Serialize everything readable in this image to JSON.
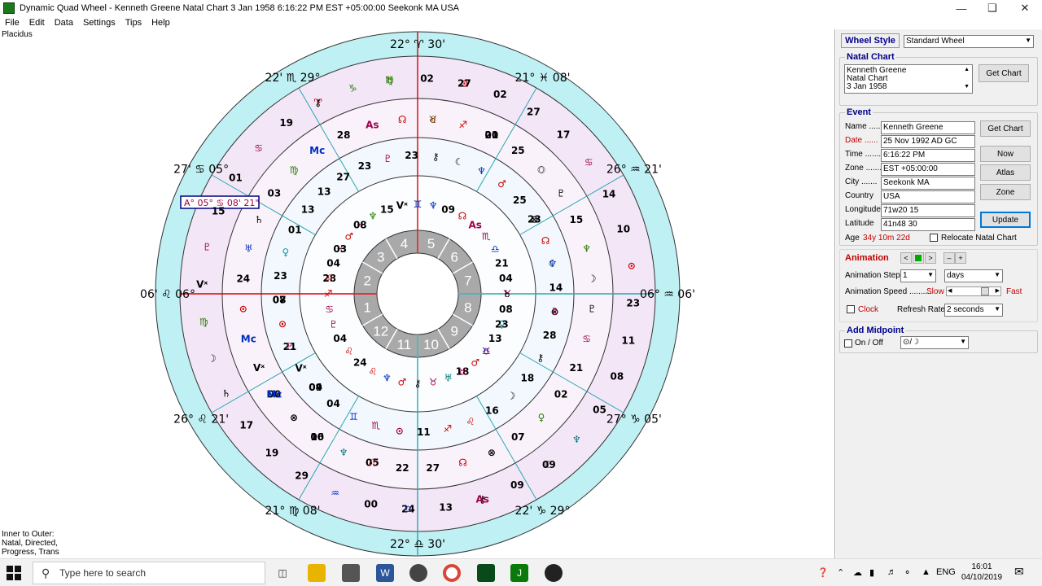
{
  "window": {
    "title": "Dynamic Quad Wheel - Kenneth Greene Natal Chart 3 Jan 1958 6:16:22 PM EST +05:00:00 Seekonk MA USA"
  },
  "menu": [
    "File",
    "Edit",
    "Data",
    "Settings",
    "Tips",
    "Help"
  ],
  "wheel": {
    "house_system": "Placidus",
    "legend": [
      "Inner to Outer:",
      "Natal, Directed,",
      "Progress, Trans"
    ],
    "asc_readout": "A° 05° ♋ 08' 21\"",
    "house_numbers": [
      "1",
      "2",
      "3",
      "4",
      "5",
      "6",
      "7",
      "8",
      "9",
      "10",
      "11",
      "12"
    ],
    "cusps": [
      {
        "deg": "22°",
        "sign": "♈",
        "min": "30'"
      },
      {
        "deg": "21°",
        "sign": "♓",
        "min": "08'"
      },
      {
        "deg": "26°",
        "sign": "♒",
        "min": "21'"
      },
      {
        "deg": "06°",
        "sign": "♒",
        "min": "06'"
      },
      {
        "deg": "27°",
        "sign": "♑",
        "min": "05'"
      },
      {
        "deg": "22'",
        "sign": "♑",
        "min": "29°"
      },
      {
        "deg": "22°",
        "sign": "♎",
        "min": "30'"
      },
      {
        "deg": "21°",
        "sign": "♍",
        "min": "08'"
      },
      {
        "deg": "26°",
        "sign": "♌",
        "min": "21'"
      },
      {
        "deg": "06'",
        "sign": "♌",
        "min": "06°"
      },
      {
        "deg": "27'",
        "sign": "♋",
        "min": "05°"
      },
      {
        "deg": "22'",
        "sign": "♏",
        "min": "29°"
      }
    ],
    "glyphs": [
      {
        "t": "♉",
        "c": "#a0004a"
      },
      {
        "t": "04",
        "c": "#000"
      },
      {
        "t": "♉",
        "c": "#2a7a00"
      },
      {
        "t": "☾",
        "c": "#000"
      },
      {
        "t": "28",
        "c": "#000"
      },
      {
        "t": "⊗",
        "c": "#000"
      },
      {
        "t": "05",
        "c": "#000"
      },
      {
        "t": "♈",
        "c": "#c00"
      },
      {
        "t": "♀",
        "c": "#00a0a0"
      },
      {
        "t": "21",
        "c": "#000"
      },
      {
        "t": "20",
        "c": "#000"
      },
      {
        "t": "⚷",
        "c": "#000"
      },
      {
        "t": "♓",
        "c": "#a0004a"
      },
      {
        "t": "☾",
        "c": "#000"
      },
      {
        "t": "00",
        "c": "#000"
      },
      {
        "t": "♉",
        "c": "#2a7a00"
      },
      {
        "t": "♉",
        "c": "#a0004a"
      },
      {
        "t": "08",
        "c": "#000"
      },
      {
        "t": "☾",
        "c": "#000"
      },
      {
        "t": "24",
        "c": "#000"
      },
      {
        "t": "♓",
        "c": "#a0004a"
      },
      {
        "t": "⊗",
        "c": "#000"
      },
      {
        "t": "00",
        "c": "#000"
      },
      {
        "t": "⊙",
        "c": "#c00"
      },
      {
        "t": "18",
        "c": "#000"
      },
      {
        "t": "♀",
        "c": "#00a0a0"
      },
      {
        "t": "15",
        "c": "#000"
      },
      {
        "t": "♒",
        "c": "#0030c0"
      },
      {
        "t": "15",
        "c": "#000"
      },
      {
        "t": "⚷",
        "c": "#000"
      },
      {
        "t": "Mc",
        "c": "#0030c0"
      },
      {
        "t": "27",
        "c": "#000"
      },
      {
        "t": "♉",
        "c": "#a0004a"
      },
      {
        "t": "13",
        "c": "#000"
      },
      {
        "t": "☽",
        "c": "#000"
      },
      {
        "t": "19",
        "c": "#000"
      },
      {
        "t": "♊",
        "c": "#0030c0"
      },
      {
        "t": "☽",
        "c": "#000"
      },
      {
        "t": "24",
        "c": "#000"
      },
      {
        "t": "♋",
        "c": "#a0004a"
      },
      {
        "t": "♂",
        "c": "#c00"
      },
      {
        "t": "27",
        "c": "#000"
      },
      {
        "t": "♋",
        "c": "#a0004a"
      },
      {
        "t": "♄",
        "c": "#000"
      },
      {
        "t": "09",
        "c": "#000"
      },
      {
        "t": "♌",
        "c": "#c00"
      },
      {
        "t": "♄",
        "c": "#000"
      },
      {
        "t": "10",
        "c": "#000"
      },
      {
        "t": "♌",
        "c": "#c00"
      },
      {
        "t": "♇",
        "c": "#a0004a"
      },
      {
        "t": "02",
        "c": "#000"
      },
      {
        "t": "♍",
        "c": "#2a7a00"
      },
      {
        "t": "As",
        "c": "#a0004a"
      },
      {
        "t": "11",
        "c": "#000"
      },
      {
        "t": "♍",
        "c": "#2a7a00"
      },
      {
        "t": "23",
        "c": "#000"
      },
      {
        "t": "♌",
        "c": "#c00"
      },
      {
        "t": "⚷",
        "c": "#000"
      },
      {
        "t": "07",
        "c": "#000"
      },
      {
        "t": "♇",
        "c": "#a0004a"
      },
      {
        "t": "♎",
        "c": "#0030c0"
      },
      {
        "t": "♏",
        "c": "#a0004a"
      },
      {
        "t": "28",
        "c": "#000"
      },
      {
        "t": "08",
        "c": "#000"
      },
      {
        "t": "♇",
        "c": "#a0004a"
      },
      {
        "t": "♆",
        "c": "#0030c0"
      },
      {
        "t": "☊",
        "c": "#c00"
      },
      {
        "t": "01",
        "c": "#000"
      },
      {
        "t": "04",
        "c": "#000"
      },
      {
        "t": "04",
        "c": "#000"
      },
      {
        "t": "☊",
        "c": "#c00"
      },
      {
        "t": "♆",
        "c": "#0a7a7a"
      },
      {
        "t": "♐",
        "c": "#c00"
      },
      {
        "t": "25",
        "c": "#000"
      },
      {
        "t": "22",
        "c": "#000"
      },
      {
        "t": "19",
        "c": "#000"
      },
      {
        "t": "08",
        "c": "#000"
      },
      {
        "t": "Vˣ",
        "c": "#000"
      },
      {
        "t": "♐",
        "c": "#c00"
      },
      {
        "t": "09",
        "c": "#000"
      },
      {
        "t": "04",
        "c": "#000"
      },
      {
        "t": "☊",
        "c": "#c00"
      },
      {
        "t": "♆",
        "c": "#0a7a7a"
      },
      {
        "t": "♑",
        "c": "#2a7a00"
      },
      {
        "t": "13",
        "c": "#000"
      },
      {
        "t": "⊙",
        "c": "#c00"
      },
      {
        "t": "25",
        "c": "#000"
      },
      {
        "t": "13",
        "c": "#000"
      },
      {
        "t": "♂",
        "c": "#c00"
      },
      {
        "t": "14",
        "c": "#000"
      },
      {
        "t": "⊗",
        "c": "#000"
      },
      {
        "t": "02",
        "c": "#000"
      },
      {
        "t": "♂",
        "c": "#c00"
      },
      {
        "t": "23",
        "c": "#000"
      },
      {
        "t": "♇",
        "c": "#000"
      },
      {
        "t": "00",
        "c": "#000"
      },
      {
        "t": "♆",
        "c": "#2a7a00"
      },
      {
        "t": "28",
        "c": "#000"
      },
      {
        "t": "Vˣ",
        "c": "#000"
      },
      {
        "t": "02",
        "c": "#000"
      },
      {
        "t": "♅",
        "c": "#0a7a7a"
      },
      {
        "t": "01",
        "c": "#000"
      },
      {
        "t": "♆",
        "c": "#2a7a00"
      },
      {
        "t": "29",
        "c": "#000"
      },
      {
        "t": "Vˣ",
        "c": "#000"
      },
      {
        "t": "18",
        "c": "#000"
      },
      {
        "t": "⊙",
        "c": "#c00"
      },
      {
        "t": "17",
        "c": "#000"
      },
      {
        "t": "⚷",
        "c": "#000"
      },
      {
        "t": "13",
        "c": "#000"
      },
      {
        "t": "♇",
        "c": "#000"
      },
      {
        "t": "17",
        "c": "#000"
      },
      {
        "t": "♆",
        "c": "#0030c0"
      },
      {
        "t": "16",
        "c": "#000"
      },
      {
        "t": "♅",
        "c": "#0030c0"
      },
      {
        "t": "14",
        "c": "#000"
      },
      {
        "t": "♆",
        "c": "#0030c0"
      },
      {
        "t": "23",
        "c": "#000"
      },
      {
        "t": "21",
        "c": "#000"
      },
      {
        "t": "☽",
        "c": "#000"
      },
      {
        "t": "☊",
        "c": "#c00"
      },
      {
        "t": "♐",
        "c": "#c00"
      },
      {
        "t": "03",
        "c": "#000"
      },
      {
        "t": "⊙",
        "c": "#c00"
      },
      {
        "t": "24",
        "c": "#000"
      },
      {
        "t": "23",
        "c": "#000"
      },
      {
        "t": "♀",
        "c": "#2a7a00"
      },
      {
        "t": "Vˣ",
        "c": "#000"
      },
      {
        "t": "♏",
        "c": "#a0004a"
      },
      {
        "t": "⊙",
        "c": "#a0004a"
      },
      {
        "t": "Mc",
        "c": "#0030c0"
      },
      {
        "t": "11",
        "c": "#000"
      },
      {
        "t": "04",
        "c": "#000"
      },
      {
        "t": "☾",
        "c": "#000"
      },
      {
        "t": "⊗",
        "c": "#000"
      },
      {
        "t": "15",
        "c": "#000"
      },
      {
        "t": "21",
        "c": "#000"
      },
      {
        "t": "♊",
        "c": "#0030c0"
      },
      {
        "t": "As",
        "c": "#a0004a"
      },
      {
        "t": "05",
        "c": "#000"
      },
      {
        "t": "♋",
        "c": "#a0004a"
      },
      {
        "t": "♂",
        "c": "#c00"
      },
      {
        "t": "27",
        "c": "#000"
      },
      {
        "t": "♋",
        "c": "#a0004a"
      },
      {
        "t": "♄",
        "c": "#000"
      },
      {
        "t": "09",
        "c": "#000"
      },
      {
        "t": "♌",
        "c": "#c00"
      },
      {
        "t": "09",
        "c": "#000"
      },
      {
        "t": "♌",
        "c": "#c00"
      },
      {
        "t": "23",
        "c": "#000"
      },
      {
        "t": "♌",
        "c": "#c00"
      },
      {
        "t": "⚷",
        "c": "#000"
      },
      {
        "t": "23",
        "c": "#000"
      },
      {
        "t": "♇",
        "c": "#a0004a"
      },
      {
        "t": "01",
        "c": "#000"
      },
      {
        "t": "As",
        "c": "#a0004a"
      },
      {
        "t": "03",
        "c": "#000"
      },
      {
        "t": "♆",
        "c": "#0030c0"
      },
      {
        "t": "16",
        "c": "#000"
      },
      {
        "t": "♍",
        "c": "#2a7a00"
      },
      {
        "t": "♎",
        "c": "#0030c0"
      },
      {
        "t": "07",
        "c": "#000"
      },
      {
        "t": "☽",
        "c": "#000"
      },
      {
        "t": "♎",
        "c": "#0030c0"
      },
      {
        "t": "08",
        "c": "#000"
      },
      {
        "t": "♇",
        "c": "#a0004a"
      },
      {
        "t": "Mc",
        "c": "#0030c0"
      },
      {
        "t": "27",
        "c": "#000"
      },
      {
        "t": "♉",
        "c": "#a0004a"
      }
    ]
  },
  "panel": {
    "wheel_style_label": "Wheel Style",
    "wheel_style_value": "Standard Wheel",
    "natal_chart_title": "Natal Chart",
    "natal_lines": [
      "Kenneth Greene",
      "Natal Chart",
      "3 Jan 1958"
    ],
    "get_chart_label": "Get Chart",
    "event_title": "Event",
    "fields": [
      {
        "label": "Name .....",
        "value": "Kenneth Greene",
        "label_color": "#000"
      },
      {
        "label": "Date ......",
        "value": "25 Nov 1992 AD GC",
        "label_color": "#c00000"
      },
      {
        "label": "Time .......",
        "value": "6:16:22 PM",
        "label_color": "#000"
      },
      {
        "label": "Zone .......",
        "value": "EST +05:00:00",
        "label_color": "#000"
      },
      {
        "label": "City .......",
        "value": "Seekonk MA",
        "label_color": "#000"
      },
      {
        "label": "Country",
        "value": "USA",
        "label_color": "#000"
      },
      {
        "label": "Longitude",
        "value": "71w20 15",
        "label_color": "#000"
      },
      {
        "label": "Latitude",
        "value": "41n48 30",
        "label_color": "#000"
      }
    ],
    "buttons": {
      "get_chart": "Get Chart",
      "now": "Now",
      "atlas": "Atlas",
      "zone": "Zone",
      "update": "Update"
    },
    "age_label": "Age",
    "age_value": "34y 10m 22d",
    "relocate_label": "Relocate Natal Chart",
    "animation_title": "Animation",
    "anim_prev": "<",
    "anim_next": ">",
    "anim_minus": "–",
    "anim_plus": "+",
    "step_label": "Animation Step",
    "step_value": "1",
    "step_unit": "days",
    "speed_label": "Animation Speed ..........",
    "slow_label": "Slow",
    "fast_label": "Fast",
    "clock_label": "Clock",
    "refresh_label": "Refresh Rate",
    "refresh_value": "2 seconds",
    "midpoint_title": "Add Midpoint",
    "onoff_label": "On / Off",
    "midpoint_value": "⊙/☽"
  },
  "taskbar": {
    "search_placeholder": "Type here to search",
    "lang": "ENG",
    "time": "16:01",
    "date": "04/10/2019"
  }
}
